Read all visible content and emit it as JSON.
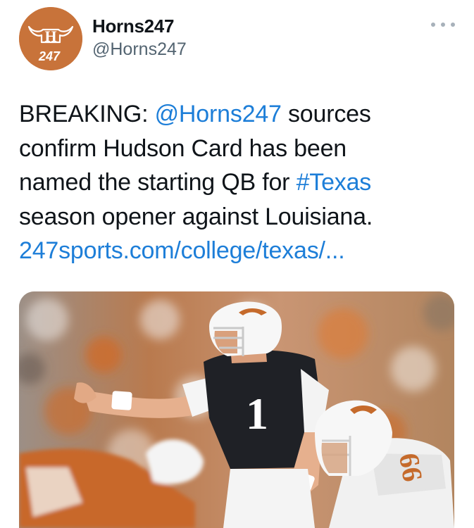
{
  "author": {
    "name": "Horns247",
    "handle": "@Horns247",
    "avatar_letter": "H",
    "avatar_text": "247"
  },
  "more_icon": "more-horizontal-icon",
  "tweet": {
    "line1_prefix": "BREAKING: ",
    "line1_mention": "@Horns247",
    "line1_suffix": " sources",
    "line2": "confirm Hudson Card has been",
    "line3_prefix": "named the starting QB for ",
    "line3_hashtag": "#Texas",
    "line4": "season opener against Louisiana.",
    "link": "247sports.com/college/texas/..."
  },
  "media": {
    "jersey_number": "1",
    "lineman_number": "66"
  },
  "colors": {
    "brand_orange": "#c8733a",
    "link_blue": "#1d7ed8",
    "handle_gray": "#536471"
  }
}
